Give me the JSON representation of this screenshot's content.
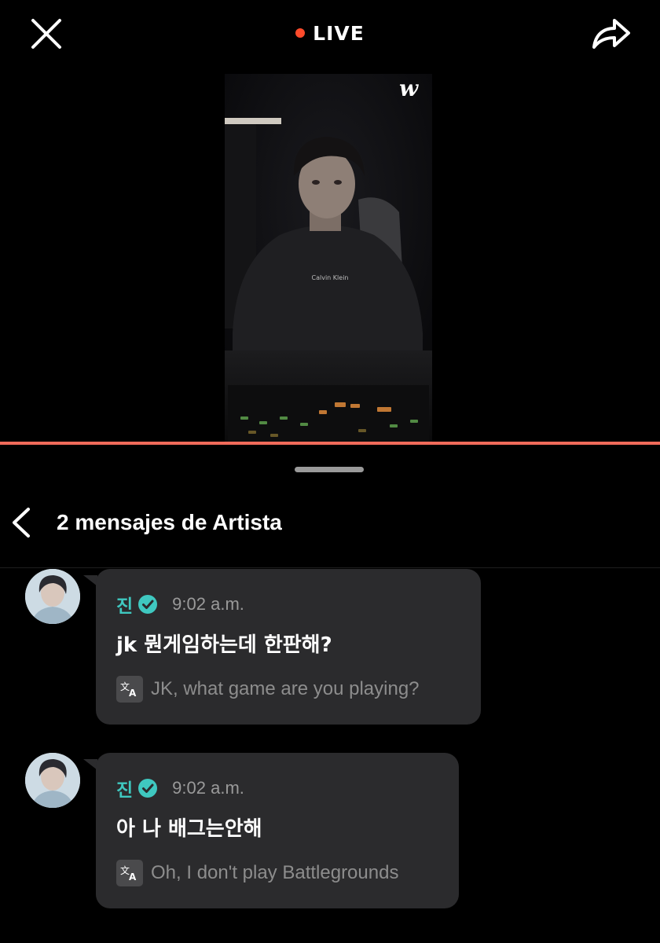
{
  "header": {
    "close_icon": "close-icon",
    "live_label": "LIVE",
    "live_color": "#ff4b2b",
    "share_icon": "share-icon"
  },
  "video": {
    "brand_mark": "w",
    "shirt_text": "Calvin Klein",
    "progress_fraction": 1.0,
    "progress_color": "#f16b5a"
  },
  "panel": {
    "back_icon": "chevron-left-icon",
    "title": "2 mensajes de Artista"
  },
  "messages": [
    {
      "author": "진",
      "time": "9:02 a.m.",
      "text": "jk  뭔게임하는데 한판해?",
      "translation": "JK, what game are you playing?",
      "verified_icon": "verified-badge-icon",
      "translate_icon": "translate-icon"
    },
    {
      "author": "진",
      "time": "9:02 a.m.",
      "text": "아 나 배그는안해",
      "translation": "Oh, I don't play Battlegrounds",
      "verified_icon": "verified-badge-icon",
      "translate_icon": "translate-icon"
    }
  ],
  "colors": {
    "author": "#3fc8c0",
    "bubble": "#2b2b2d",
    "background": "#000000"
  }
}
